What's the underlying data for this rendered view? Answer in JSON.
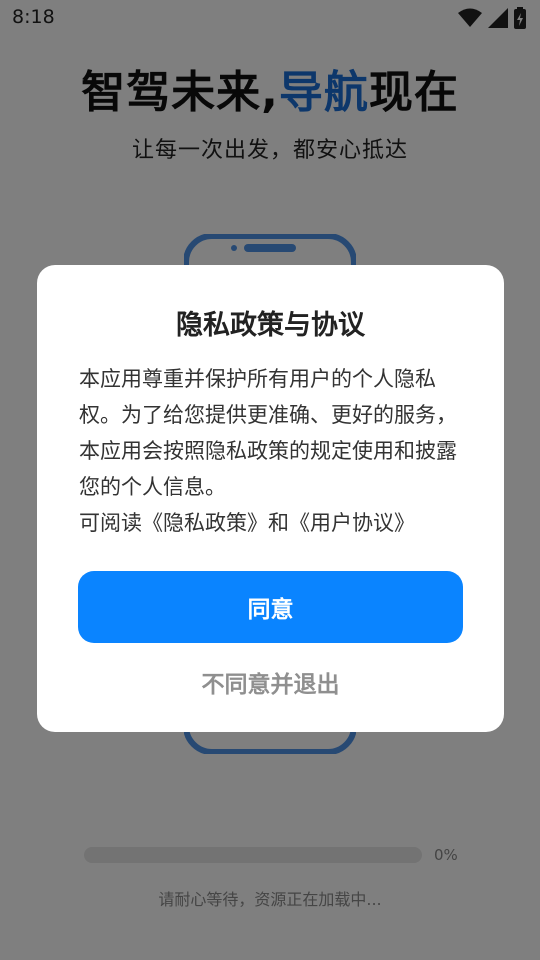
{
  "status_bar": {
    "time": "8:18",
    "icons": [
      "wifi-icon",
      "signal-icon",
      "battery-icon"
    ]
  },
  "hero": {
    "title_part1": "智驾未来,",
    "title_accent": "导航",
    "title_part2": "现在",
    "subtitle": "让每一次出发，都安心抵达"
  },
  "loading": {
    "progress": 0,
    "progress_text": "0%",
    "message": "请耐心等待，资源正在加载中..."
  },
  "dialog": {
    "title": "隐私政策与协议",
    "body": "本应用尊重并保护所有用户的个人隐私权。为了给您提供更准确、更好的服务，本应用会按照隐私政策的规定使用和披露您的个人信息。",
    "read_prefix": "可阅读",
    "privacy_link": "《隐私政策》",
    "read_and": "和",
    "agreement_link": "《用户协议》",
    "agree_label": "同意",
    "decline_label": "不同意并退出"
  },
  "colors": {
    "accent": "#1a6fd6",
    "primary_button": "#0a84ff",
    "overlay": "rgba(0,0,0,0.5)"
  }
}
